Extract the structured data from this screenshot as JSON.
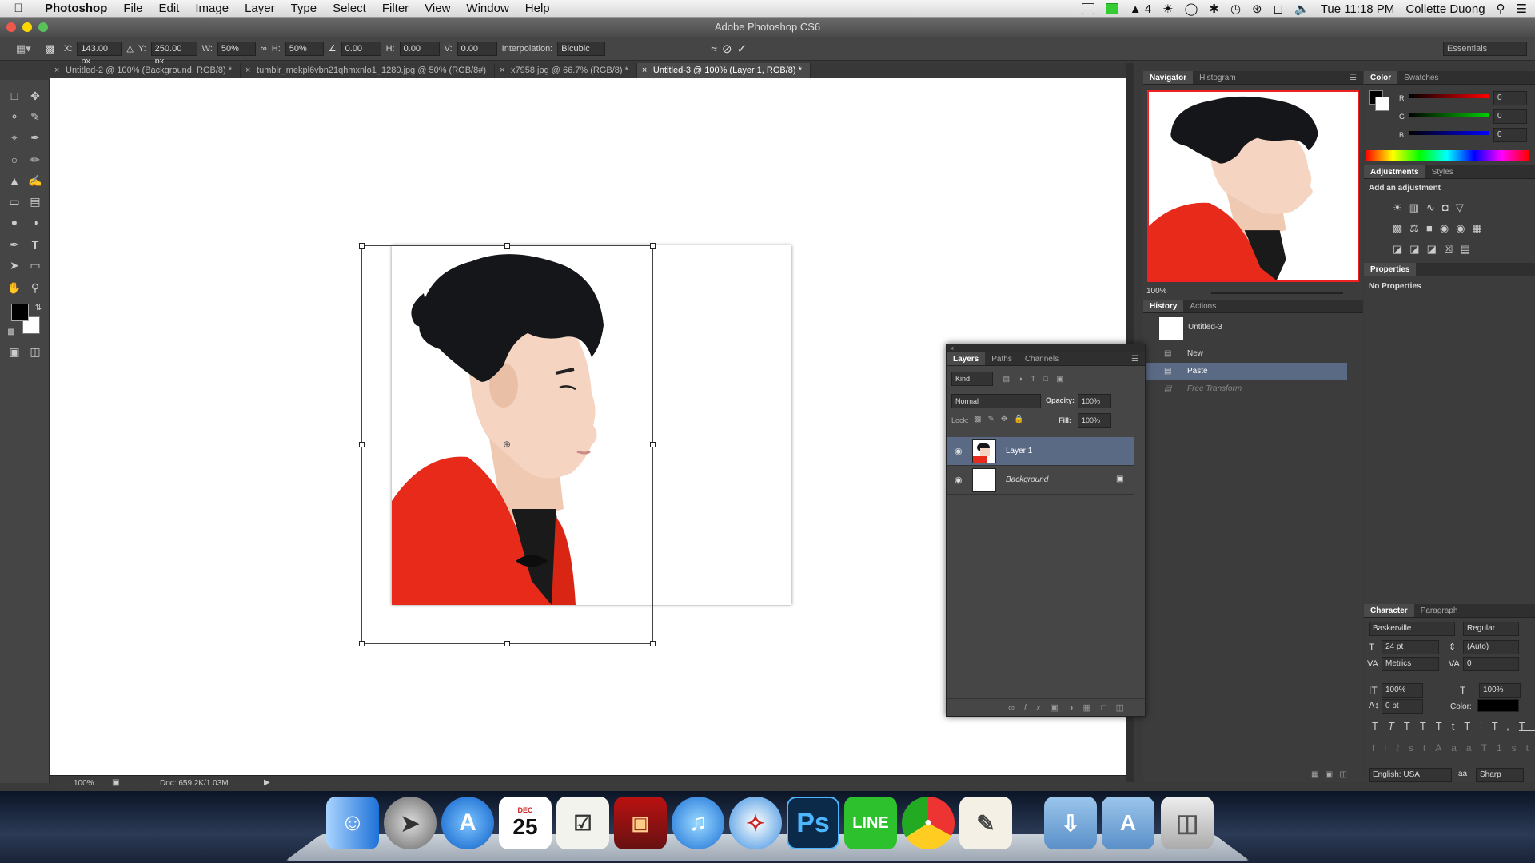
{
  "menubar": {
    "app_name": "Photoshop",
    "items": [
      "File",
      "Edit",
      "Image",
      "Layer",
      "Type",
      "Select",
      "Filter",
      "View",
      "Window",
      "Help"
    ],
    "status_ai_count": "4",
    "clock": "Tue 11:18 PM",
    "user": "Collette Duong"
  },
  "window": {
    "title": "Adobe Photoshop CS6"
  },
  "options": {
    "x_label": "X:",
    "x_value": "143.00 px",
    "y_label": "Y:",
    "y_value": "250.00 px",
    "w_label": "W:",
    "w_value": "50%",
    "h_label": "H:",
    "h_value": "50%",
    "rotate_value": "0.00",
    "skew_h_label": "H:",
    "skew_h_value": "0.00",
    "skew_v_label": "V:",
    "skew_v_value": "0.00",
    "interpolation_label": "Interpolation:",
    "interpolation_value": "Bicubic",
    "workspace": "Essentials"
  },
  "tabs": [
    {
      "label": "Untitled-2 @ 100% (Background, RGB/8) *"
    },
    {
      "label": "tumblr_mekpl6vbn21qhmxnlo1_1280.jpg @ 50% (RGB/8#)"
    },
    {
      "label": "x7958.jpg @ 66.7% (RGB/8) *"
    },
    {
      "label": "Untitled-3 @ 100% (Layer 1, RGB/8) *"
    }
  ],
  "status": {
    "zoom": "100%",
    "doc": "Doc: 659.2K/1.03M"
  },
  "navigator": {
    "tabs": [
      "Navigator",
      "Histogram"
    ],
    "zoom": "100%"
  },
  "history": {
    "tabs": [
      "History",
      "Actions"
    ],
    "snapshot": "Untitled-3",
    "steps": [
      "New",
      "Paste",
      "Free Transform"
    ]
  },
  "color": {
    "tabs": [
      "Color",
      "Swatches"
    ],
    "r_label": "R",
    "r_value": "0",
    "g_label": "G",
    "g_value": "0",
    "b_label": "B",
    "b_value": "0"
  },
  "adjustments": {
    "tabs": [
      "Adjustments",
      "Styles"
    ],
    "hint": "Add an adjustment"
  },
  "properties": {
    "title": "Properties",
    "empty": "No Properties"
  },
  "layers": {
    "tabs": [
      "Layers",
      "Paths",
      "Channels"
    ],
    "filter": "Kind",
    "blend": "Normal",
    "opacity_label": "Opacity:",
    "opacity": "100%",
    "lock_label": "Lock:",
    "fill_label": "Fill:",
    "fill": "100%",
    "items": [
      {
        "name": "Layer 1"
      },
      {
        "name": "Background"
      }
    ]
  },
  "character": {
    "tabs": [
      "Character",
      "Paragraph"
    ],
    "font": "Baskerville",
    "style": "Regular",
    "size": "24 pt",
    "leading": "(Auto)",
    "kerning": "Metrics",
    "tracking": "0",
    "vscale": "100%",
    "hscale": "100%",
    "baseline": "0 pt",
    "color_label": "Color:",
    "language": "English: USA",
    "aa": "Sharp"
  },
  "dock": {
    "photoshop_label": "Ps",
    "line_label": "LINE",
    "calendar_month": "DEC",
    "calendar_day": "25"
  }
}
